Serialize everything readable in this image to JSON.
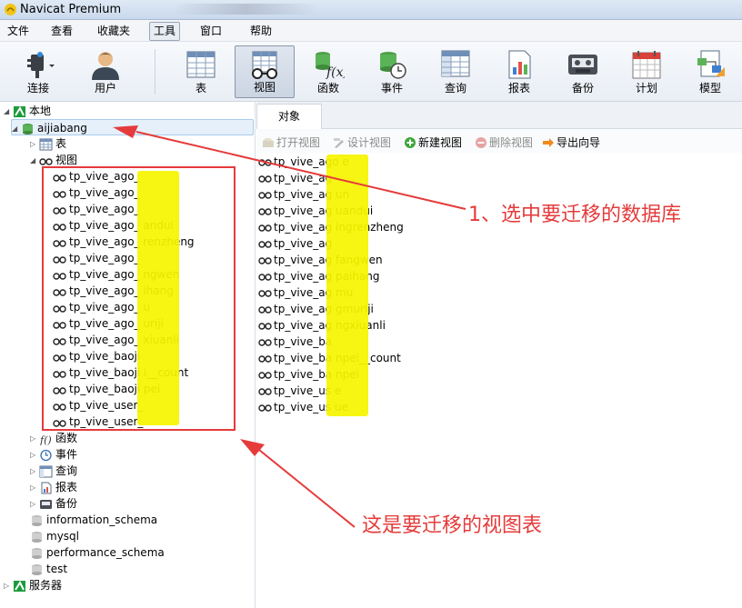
{
  "window": {
    "title": "Navicat Premium"
  },
  "menu": [
    "文件",
    "查看",
    "收藏夹",
    "工具",
    "窗口",
    "帮助"
  ],
  "menu_active": "工具",
  "toolbar": {
    "items": [
      {
        "label": "连接",
        "icon": "plug-icon"
      },
      {
        "label": "用户",
        "icon": "user-icon"
      },
      {
        "label": "表",
        "icon": "table-icon"
      },
      {
        "label": "视图",
        "icon": "glasses-icon"
      },
      {
        "label": "函数",
        "icon": "function-icon"
      },
      {
        "label": "事件",
        "icon": "event-icon"
      },
      {
        "label": "查询",
        "icon": "query-icon"
      },
      {
        "label": "报表",
        "icon": "report-icon"
      },
      {
        "label": "备份",
        "icon": "backup-icon"
      },
      {
        "label": "计划",
        "icon": "calendar-icon"
      },
      {
        "label": "模型",
        "icon": "model-icon"
      }
    ],
    "active": "视图"
  },
  "tree": {
    "local": "本地",
    "db": "aijiabang",
    "tables": "表",
    "views": "视图",
    "view_items": [
      "tp_vive_ago_",
      "tp_vive_ago_",
      "tp_vive_ago_",
      "tp_vive_ago_           andui",
      "tp_vive_ago_           renzheng",
      "tp_vive_ago_",
      "tp_vive_ago_           ngwen",
      "tp_vive_ago_           ihang",
      "tp_vive_ago_           u",
      "tp_vive_ago_           uriji",
      "tp_vive_ago_           xiuanli",
      "tp_vive_baoji",
      "tp_vive_baoji          i__count",
      "tp_vive_baoji          pei",
      "tp_vive_user_",
      "tp_vive_user_"
    ],
    "functions": "函数",
    "events": "事件",
    "queries": "查询",
    "reports": "报表",
    "backups": "备份",
    "other_dbs": [
      "information_schema",
      "mysql",
      "performance_schema",
      "test"
    ],
    "servers": "服务器"
  },
  "right": {
    "tab": "对象",
    "actions": [
      {
        "label": "打开视图",
        "enabled": false
      },
      {
        "label": "设计视图",
        "enabled": false
      },
      {
        "label": "新建视图",
        "enabled": true
      },
      {
        "label": "删除视图",
        "enabled": false
      },
      {
        "label": "导出向导",
        "enabled": true
      }
    ],
    "views": [
      "tp_vive_ago           e",
      "tp_vive_ag",
      "tp_vive_ag            un",
      "tp_vive_ag            uandui",
      "tp_vive_ag            ingrenzheng",
      "tp_vive_ag",
      "tp_vive_ag            fangwen",
      "tp_vive_ag            paihang",
      "tp_vive_ag            mu",
      "tp_vive_ag            gmuriji",
      "tp_vive_ag            ngxiuanli",
      "tp_vive_ba",
      "tp_vive_ba            npei__count",
      "tp_vive_ba            npei",
      "tp_vive_us            e",
      "tp_vive_us            ue"
    ]
  },
  "annotations": {
    "note1": "1、选中要迁移的数据库",
    "note2": "这是要迁移的视图表",
    "color": "#e53b3b"
  }
}
